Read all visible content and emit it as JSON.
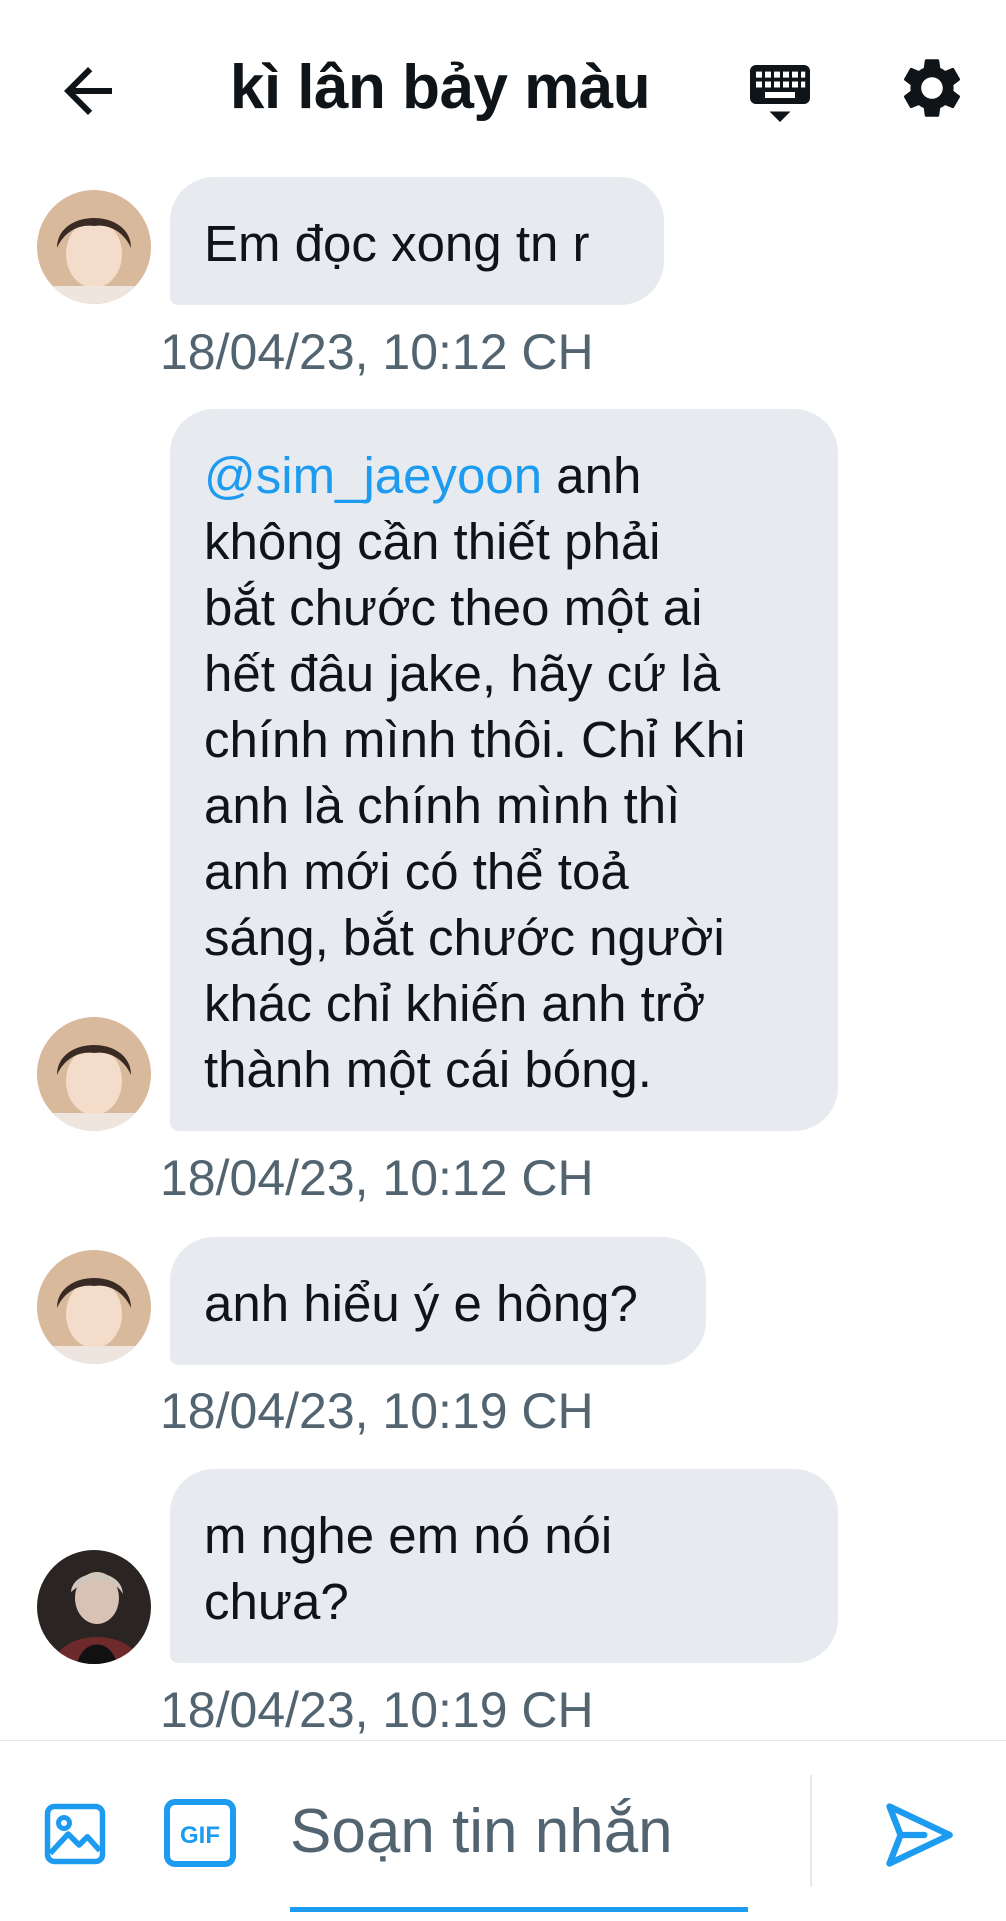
{
  "header": {
    "title": "kì lân bảy màu",
    "back_icon": "arrow-left-icon",
    "keyboard_icon": "keyboard-icon",
    "settings_icon": "gear-icon"
  },
  "messages": [
    {
      "avatar": "avatar-photo",
      "text": "Em đọc xong tn r",
      "timestamp": "18/04/23, 10:12 CH"
    },
    {
      "avatar": "avatar-photo",
      "mention": "@sim_jaeyoon",
      "lines": [
        " anh",
        "không cần thiết phải",
        "bắt chước theo một ai",
        "hết đâu jake, hãy cứ là",
        "chính mình thôi. Chỉ Khi",
        "anh là chính mình thì",
        "anh mới có thể toả",
        "sáng, bắt chước người",
        "khác chỉ khiến anh trở",
        "thành một cái bóng."
      ],
      "timestamp": "18/04/23, 10:12 CH"
    },
    {
      "avatar": "avatar-photo",
      "text": "anh hiểu ý e hông?",
      "timestamp": "18/04/23, 10:19 CH"
    },
    {
      "avatar": "avatar-photo-dark",
      "lines": [
        "m nghe em nó nói",
        "chưa?"
      ],
      "timestamp": "18/04/23, 10:19 CH"
    }
  ],
  "composer": {
    "placeholder": "Soạn tin nhắn",
    "value": "",
    "image_icon": "image-icon",
    "gif_icon": "gif-icon",
    "gif_label": "GIF",
    "send_icon": "send-icon"
  },
  "colors": {
    "accent": "#1d9bf0",
    "bubble": "#e7ebef",
    "timestamp": "#536471",
    "text": "#0f1419"
  }
}
